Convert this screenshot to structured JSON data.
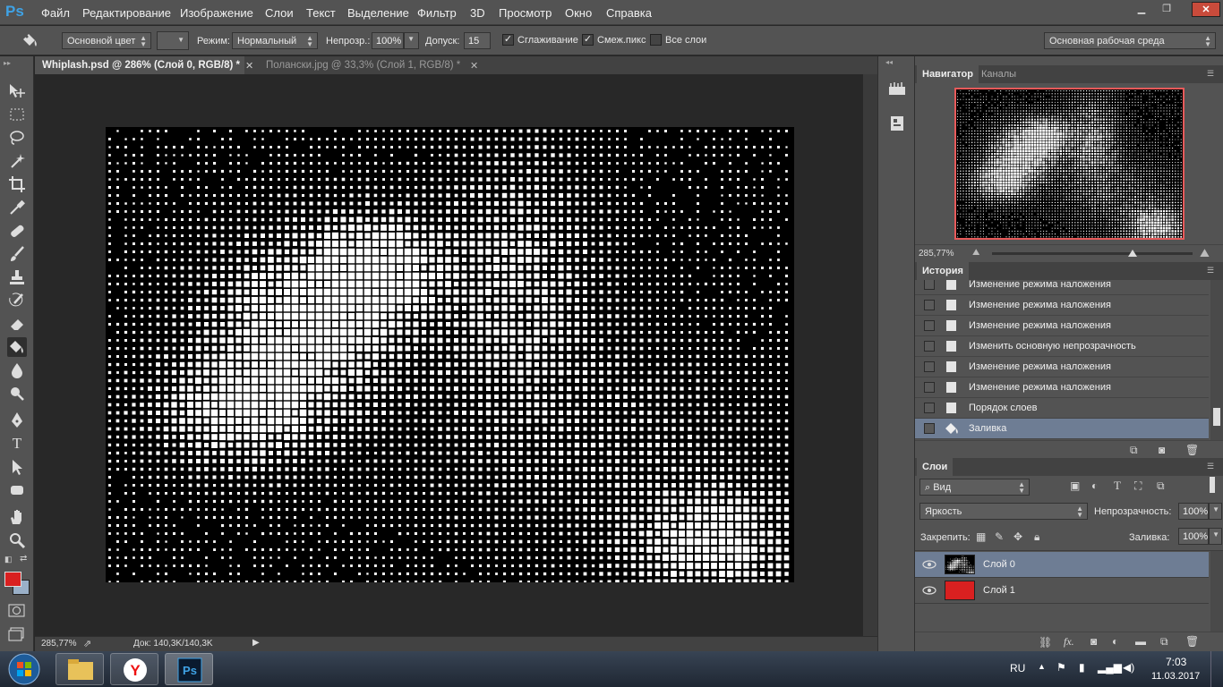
{
  "app": {
    "logo": "Ps"
  },
  "menu": [
    "Файл",
    "Редактирование",
    "Изображение",
    "Слои",
    "Текст",
    "Выделение",
    "Фильтр",
    "3D",
    "Просмотр",
    "Окно",
    "Справка"
  ],
  "options": {
    "fill_source": "Основной цвет",
    "mode_label": "Режим:",
    "mode_value": "Нормальный",
    "opacity_label": "Непрозр.:",
    "opacity_value": "100%",
    "tolerance_label": "Допуск:",
    "tolerance_value": "15",
    "antialias_label": "Сглаживание",
    "antialias_checked": true,
    "contiguous_label": "Смеж.пикс",
    "contiguous_checked": true,
    "all_layers_label": "Все слои",
    "all_layers_checked": false,
    "workspace": "Основная рабочая среда"
  },
  "doc_tabs": [
    {
      "label": "Whiplash.psd @ 286% (Слой 0, RGB/8) *",
      "active": true
    },
    {
      "label": "Polanski.jpg",
      "display": "Полански.jpg @ 33,3% (Слой 1, RGB/8) *",
      "active": false
    }
  ],
  "status": {
    "zoom": "285,77%",
    "doc": "Док: 140,3K/140,3K"
  },
  "navigator": {
    "tab_active": "Навигатор",
    "tab_other": "Каналы",
    "zoom": "285,77%",
    "zoom_level": 0.7
  },
  "history": {
    "title": "История",
    "items": [
      "Изменение режима наложения",
      "Изменение режима наложения",
      "Изменение режима наложения",
      "Изменить основную непрозрачность",
      "Изменение режима наложения",
      "Изменение режима наложения",
      "Порядок слоев",
      "Заливка"
    ],
    "selected_index": 7
  },
  "layers": {
    "title": "Слои",
    "filter": "Вид",
    "blend_mode": "Яркость",
    "opacity_label": "Непрозрачность:",
    "opacity_value": "100%",
    "lock_label": "Закрепить:",
    "fill_label": "Заливка:",
    "fill_value": "100%",
    "items": [
      {
        "name": "Слой 0",
        "selected": true,
        "thumb": "halftone"
      },
      {
        "name": "Слой 1",
        "selected": false,
        "thumb": "#d92020"
      }
    ]
  },
  "colors": {
    "foreground": "#d92020",
    "background": "#9ab0c8",
    "selected_row": "#6e7d94"
  },
  "taskbar": {
    "lang": "RU",
    "time": "7:03",
    "date": "11.03.2017",
    "apps": [
      "start-orb",
      "explorer",
      "yandex-browser",
      "photoshop"
    ]
  }
}
